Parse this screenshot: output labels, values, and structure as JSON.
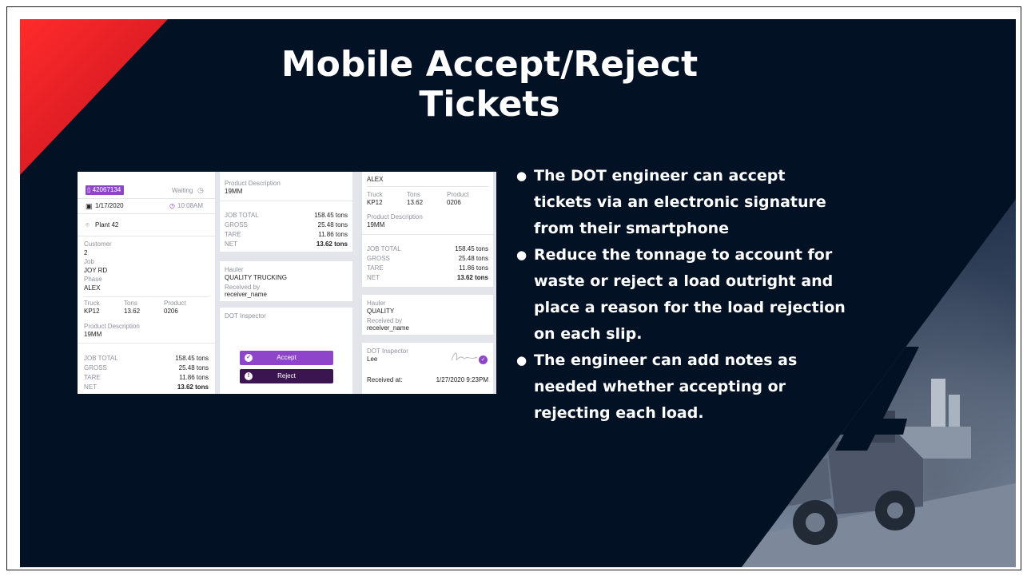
{
  "slide": {
    "title_line1": "Mobile Accept/Reject",
    "title_line2": "Tickets"
  },
  "colors": {
    "background": "#021124",
    "accent_red": "#e31b23",
    "app_purple": "#8e45c9",
    "app_dark_purple": "#3a1550"
  },
  "app_screenshot": {
    "panel1": {
      "ticket_number": "42067134",
      "status": "Waiting",
      "date": "1/17/2020",
      "time": "10:08AM",
      "plant": "Plant 42",
      "customer_label": "Customer",
      "customer_value": "2",
      "job_label": "Job",
      "job_value": "JOY RD",
      "phase_label": "Phase",
      "phase_value": "ALEX",
      "truck_label": "Truck",
      "truck_value": "KP12",
      "tons_label": "Tons",
      "tons_value": "13.62",
      "product_label": "Product",
      "product_value": "0206",
      "product_desc_label": "Product Description",
      "product_desc_value": "19MM",
      "job_total_label": "JOB TOTAL",
      "job_total_value": "158.45 tons",
      "gross_label": "GROSS",
      "gross_value": "25.48 tons",
      "tare_label": "TARE",
      "tare_value": "11.86 tons",
      "net_label": "NET",
      "net_value": "13.62 tons"
    },
    "panel2": {
      "product_desc_label": "Product Description",
      "product_desc_value": "19MM",
      "job_total_label": "JOB TOTAL",
      "job_total_value": "158.45 tons",
      "gross_label": "GROSS",
      "gross_value": "25.48 tons",
      "tare_label": "TARE",
      "tare_value": "11.86 tons",
      "net_label": "NET",
      "net_value": "13.62 tons",
      "hauler_label": "Hauler",
      "hauler_value": "QUALITY TRUCKING",
      "received_by_label": "Received by",
      "received_by_value": "receiver_name",
      "dot_inspector_label": "DOT Inspector",
      "accept_label": "Accept",
      "reject_label": "Reject"
    },
    "panel3": {
      "phase_value": "ALEX",
      "truck_label": "Truck",
      "truck_value": "KP12",
      "tons_label": "Tons",
      "tons_value": "13.62",
      "product_label": "Product",
      "product_value": "0206",
      "product_desc_label": "Product Description",
      "product_desc_value": "19MM",
      "job_total_label": "JOB TOTAL",
      "job_total_value": "158.45 tons",
      "gross_label": "GROSS",
      "gross_value": "25.48 tons",
      "tare_label": "TARE",
      "tare_value": "11.86 tons",
      "net_label": "NET",
      "net_value": "13.62 tons",
      "hauler_label": "Hauler",
      "hauler_value": "QUALITY",
      "received_by_label": "Received by",
      "received_by_value": "receiver_name",
      "dot_inspector_label": "DOT Inspector",
      "inspector_name": "Lee",
      "received_at_label": "Received at:",
      "received_at_value": "1/27/2020 9:23PM"
    }
  },
  "bullets": [
    "The DOT engineer can accept tickets via an electronic signature from their smartphone",
    "Reduce the tonnage to account for waste or reject a load outright and place a reason for the load rejection on each slip.",
    "The engineer can add notes as needed whether accepting or rejecting each load."
  ],
  "bullet_lines": [
    [
      "The DOT engineer can accept",
      "tickets via an electronic signature",
      "from their smartphone"
    ],
    [
      "Reduce the tonnage to account for",
      "waste or reject a load outright and",
      "place a reason for the load rejection",
      "on each slip."
    ],
    [
      "The engineer can add notes as",
      "needed whether accepting or",
      "rejecting each load."
    ]
  ],
  "bullet_symbol": "●",
  "icons": [
    "bookmark-icon",
    "clock-icon",
    "calendar-icon",
    "location-pin-icon",
    "checkmark-icon",
    "exclamation-icon",
    "signature-image"
  ]
}
